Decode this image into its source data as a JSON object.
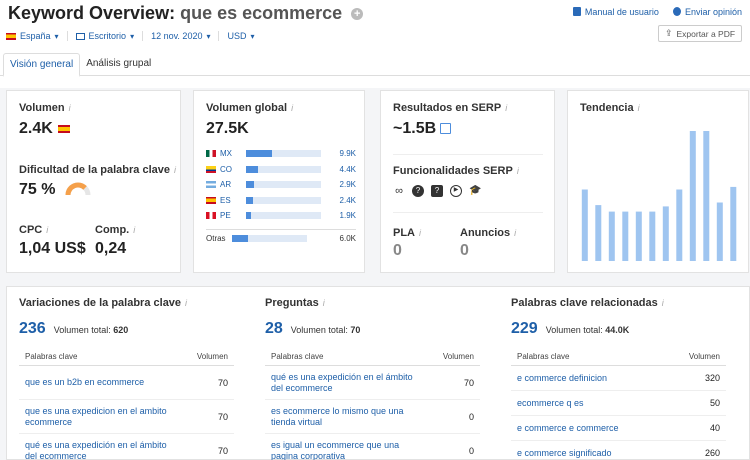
{
  "header": {
    "title_prefix": "Keyword Overview:",
    "keyword": "que es ecommerce",
    "manual_label": "Manual de usuario",
    "feedback_label": "Enviar opinión",
    "export_label": "Exportar a PDF"
  },
  "filters": {
    "country": "España",
    "device": "Escritorio",
    "date": "12 nov. 2020",
    "currency": "USD"
  },
  "tabs": [
    "Visión general",
    "Análisis grupal"
  ],
  "volume_card": {
    "volume_label": "Volumen",
    "volume_value": "2.4K",
    "kd_label": "Dificultad de la palabra clave",
    "kd_value": "75 %",
    "kd_gauge_percent": 75,
    "cpc_label": "CPC",
    "cpc_value": "1,04 US$",
    "comp_label": "Comp.",
    "comp_value": "0,24"
  },
  "global_card": {
    "label": "Volumen global",
    "value": "27.5K",
    "countries": [
      {
        "code": "MX",
        "flag": "mx",
        "value": "9.9K",
        "share": 0.36
      },
      {
        "code": "CO",
        "flag": "co",
        "value": "4.4K",
        "share": 0.16
      },
      {
        "code": "AR",
        "flag": "ar",
        "value": "2.9K",
        "share": 0.11
      },
      {
        "code": "ES",
        "flag": "es",
        "value": "2.4K",
        "share": 0.09
      },
      {
        "code": "PE",
        "flag": "pe",
        "value": "1.9K",
        "share": 0.07
      }
    ],
    "other_label": "Otras",
    "other_value": "6.0K",
    "other_share": 0.22
  },
  "serp_card": {
    "results_label": "Resultados en SERP",
    "results_value": "~1.5B",
    "features_label": "Funcionalidades SERP",
    "feature_icons": [
      "link-icon",
      "question-icon",
      "faq-icon",
      "video-icon",
      "knowledge-icon"
    ],
    "pla_label": "PLA",
    "pla_value": "0",
    "ads_label": "Anuncios",
    "ads_value": "0"
  },
  "trend_card": {
    "label": "Tendencia",
    "values": [
      0.55,
      0.43,
      0.38,
      0.38,
      0.38,
      0.38,
      0.42,
      0.55,
      1.0,
      1.0,
      0.45,
      0.57
    ]
  },
  "variations": {
    "label": "Variaciones de la palabra clave",
    "count": "236",
    "total_label": "Volumen total:",
    "total_value": "620",
    "col_kw": "Palabras clave",
    "col_vol": "Volumen",
    "rows": [
      {
        "kw": "que es un b2b en ecommerce",
        "v": "70"
      },
      {
        "kw": "que es una expedicion en el ambito ecommerce",
        "v": "70"
      },
      {
        "kw": "qué es una expedición en el ámbito del ecommerce",
        "v": "70"
      }
    ]
  },
  "questions": {
    "label": "Preguntas",
    "count": "28",
    "total_label": "Volumen total:",
    "total_value": "70",
    "col_kw": "Palabras clave",
    "col_vol": "Volumen",
    "rows": [
      {
        "kw": "qué es una expedición en el ámbito del ecommerce",
        "v": "70"
      },
      {
        "kw": "es ecommerce lo mismo que una tienda virtual",
        "v": "0"
      },
      {
        "kw": "es igual un ecommerce que una pagina corporativa",
        "v": "0"
      }
    ]
  },
  "related": {
    "label": "Palabras clave relacionadas",
    "count": "229",
    "total_label": "Volumen total:",
    "total_value": "44.0K",
    "col_kw": "Palabras clave",
    "col_vol": "Volumen",
    "rows": [
      {
        "kw": "e commerce definicion",
        "v": "320"
      },
      {
        "kw": "ecommerce q es",
        "v": "50"
      },
      {
        "kw": "e commerce e commerce",
        "v": "40"
      },
      {
        "kw": "e commerce significado",
        "v": "260"
      }
    ]
  },
  "colors": {
    "accent": "#1e5fa8",
    "bar": "#4d8ddc",
    "trend_bar": "#9fc5f0",
    "gauge": "#f5a04a"
  }
}
